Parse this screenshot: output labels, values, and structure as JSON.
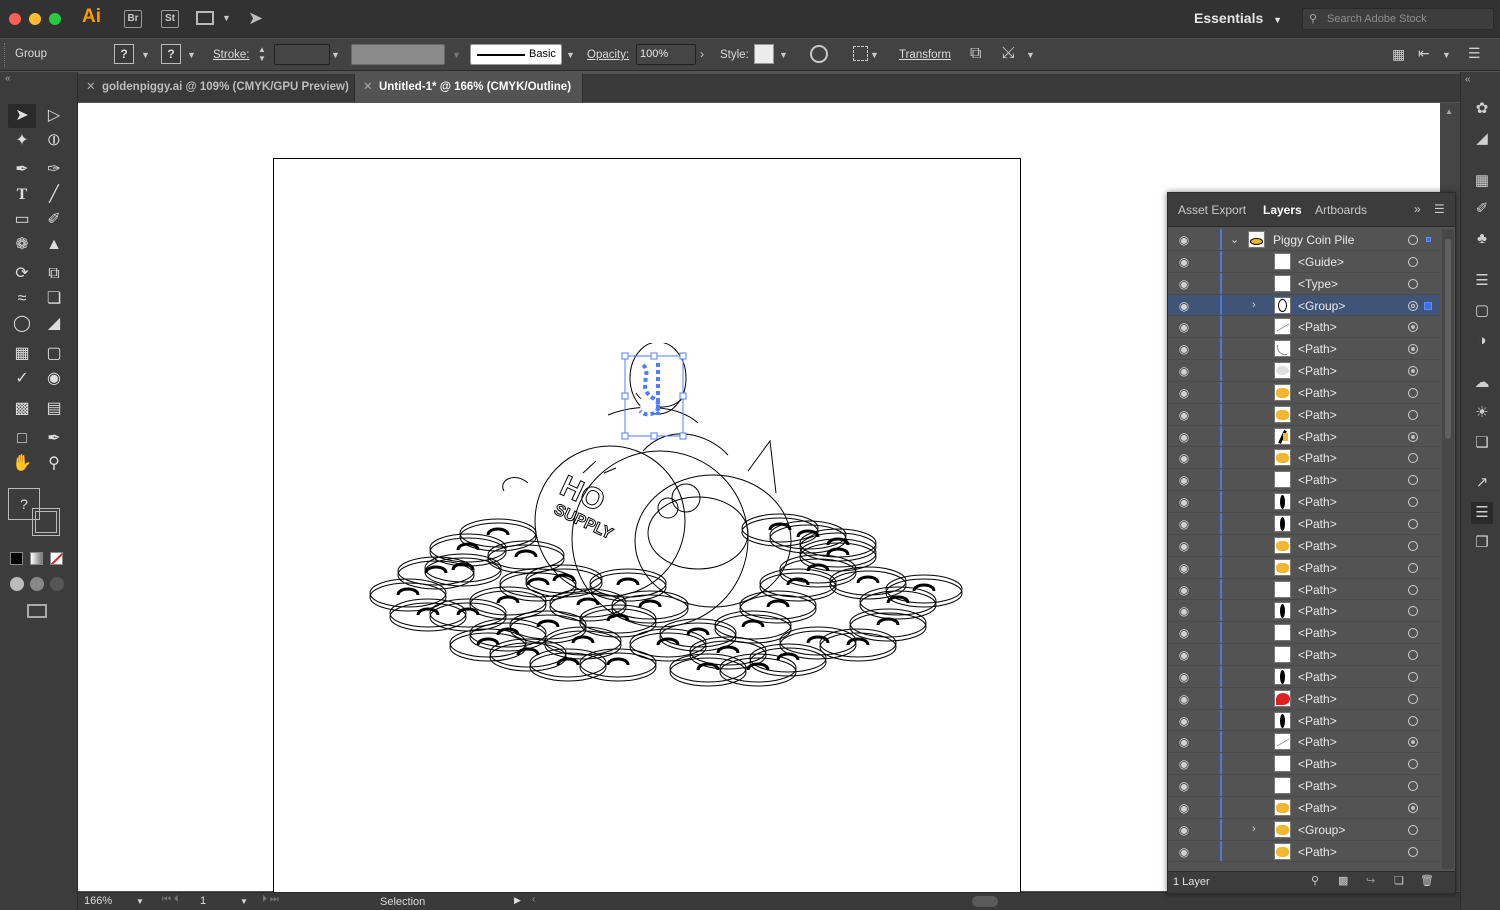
{
  "app": {
    "name": "Ai",
    "bridge": "Br",
    "stock": "St"
  },
  "workspace": {
    "label": "Essentials",
    "search_placeholder": "Search Adobe Stock"
  },
  "control": {
    "selection_type": "Group",
    "stroke_label": "Stroke:",
    "brush_label": "Basic",
    "opacity_label": "Opacity:",
    "opacity_value": "100%",
    "style_label": "Style:",
    "transform_label": "Transform",
    "fill_unknown": "?",
    "stroke_unknown": "?"
  },
  "tabs": [
    {
      "label": "goldenpiggy.ai @ 109% (CMYK/GPU Preview)",
      "active": false
    },
    {
      "label": "Untitled-1* @ 166% (CMYK/Outline)",
      "active": true
    }
  ],
  "status": {
    "zoom": "166%",
    "artboard": "1",
    "tool": "Selection"
  },
  "panel": {
    "tabs": [
      "Asset Export",
      "Layers",
      "Artboards"
    ],
    "active_tab": "Layers",
    "footer": "1 Layer",
    "layers": [
      {
        "name": "Piggy Coin Pile",
        "twisty": "open",
        "thumb": "pile",
        "target": "empty",
        "selected": false
      },
      {
        "name": "<Guide>",
        "twisty": "",
        "thumb": "blank",
        "target": "empty",
        "selected": false
      },
      {
        "name": "<Type>",
        "twisty": "",
        "thumb": "blank",
        "target": "empty",
        "selected": false
      },
      {
        "name": "<Group>",
        "twisty": "closed",
        "thumb": "piggy",
        "target": "double",
        "selected": true
      },
      {
        "name": "<Path>",
        "twisty": "",
        "thumb": "grayline",
        "target": "fill",
        "selected": false
      },
      {
        "name": "<Path>",
        "twisty": "",
        "thumb": "curve",
        "target": "fill",
        "selected": false
      },
      {
        "name": "<Path>",
        "twisty": "",
        "thumb": "grayblob",
        "target": "fill",
        "selected": false
      },
      {
        "name": "<Path>",
        "twisty": "",
        "thumb": "yellow",
        "target": "empty",
        "selected": false
      },
      {
        "name": "<Path>",
        "twisty": "",
        "thumb": "yellow",
        "target": "empty",
        "selected": false
      },
      {
        "name": "<Path>",
        "twisty": "",
        "thumb": "blackstroke",
        "target": "fill",
        "selected": false
      },
      {
        "name": "<Path>",
        "twisty": "",
        "thumb": "yellow",
        "target": "empty",
        "selected": false
      },
      {
        "name": "<Path>",
        "twisty": "",
        "thumb": "blank",
        "target": "empty",
        "selected": false
      },
      {
        "name": "<Path>",
        "twisty": "",
        "thumb": "black",
        "target": "empty",
        "selected": false
      },
      {
        "name": "<Path>",
        "twisty": "",
        "thumb": "black",
        "target": "empty",
        "selected": false
      },
      {
        "name": "<Path>",
        "twisty": "",
        "thumb": "yellow",
        "target": "empty",
        "selected": false
      },
      {
        "name": "<Path>",
        "twisty": "",
        "thumb": "yellow",
        "target": "empty",
        "selected": false
      },
      {
        "name": "<Path>",
        "twisty": "",
        "thumb": "blank",
        "target": "empty",
        "selected": false
      },
      {
        "name": "<Path>",
        "twisty": "",
        "thumb": "black",
        "target": "empty",
        "selected": false
      },
      {
        "name": "<Path>",
        "twisty": "",
        "thumb": "blank",
        "target": "empty",
        "selected": false
      },
      {
        "name": "<Path>",
        "twisty": "",
        "thumb": "blank",
        "target": "empty",
        "selected": false
      },
      {
        "name": "<Path>",
        "twisty": "",
        "thumb": "black",
        "target": "empty",
        "selected": false
      },
      {
        "name": "<Path>",
        "twisty": "",
        "thumb": "red",
        "target": "empty",
        "selected": false
      },
      {
        "name": "<Path>",
        "twisty": "",
        "thumb": "black",
        "target": "empty",
        "selected": false
      },
      {
        "name": "<Path>",
        "twisty": "",
        "thumb": "grayline",
        "target": "fill",
        "selected": false
      },
      {
        "name": "<Path>",
        "twisty": "",
        "thumb": "blank",
        "target": "empty",
        "selected": false
      },
      {
        "name": "<Path>",
        "twisty": "",
        "thumb": "blank",
        "target": "empty",
        "selected": false
      },
      {
        "name": "<Path>",
        "twisty": "",
        "thumb": "yellow",
        "target": "fill",
        "selected": false
      },
      {
        "name": "<Group>",
        "twisty": "closed",
        "thumb": "yellow",
        "target": "empty",
        "selected": false
      },
      {
        "name": "<Path>",
        "twisty": "",
        "thumb": "yellow",
        "target": "empty",
        "selected": false
      }
    ]
  },
  "colors": {
    "accent": "#4b7ad6",
    "selection": "#4f7dff",
    "coin_yellow": "#f1b732",
    "red": "#e02020"
  }
}
